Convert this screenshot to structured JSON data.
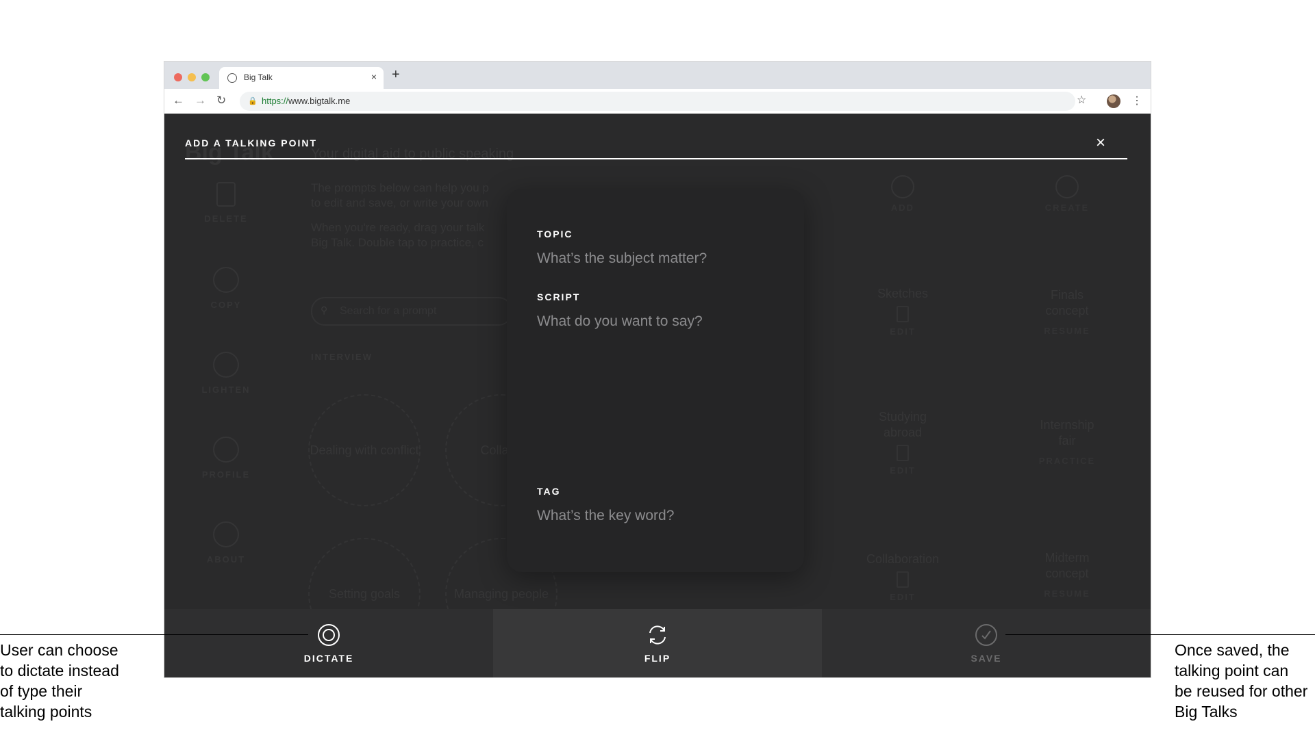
{
  "browser": {
    "tab_title": "Big Talk",
    "tab_close": "×",
    "new_tab": "+",
    "back": "←",
    "forward": "→",
    "reload": "↻",
    "lock": "🔒",
    "url_scheme": "https://",
    "url_host": "www.bigtalk.me",
    "bookmark_star": "☆",
    "menu": "⋮"
  },
  "background_app": {
    "app_title": "Big Talk",
    "tagline": "Your digital aid to public speaking",
    "intro_line1": "The prompts below can help you p",
    "intro_line1b": "to edit and save, or write your own",
    "intro_line2": "When you're ready, drag your talk",
    "intro_line2b": "Big Talk. Double tap to practice, c",
    "search_placeholder": "Search for a prompt",
    "category_tab": "INTERVIEW",
    "sidebar": [
      {
        "label": "DELETE"
      },
      {
        "label": "COPY"
      },
      {
        "label": "LIGHTEN"
      },
      {
        "label": "PROFILE"
      },
      {
        "label": "ABOUT"
      }
    ],
    "prompts": [
      "Dealing with conflict",
      "Collabo",
      "Setting goals",
      "Managing people"
    ],
    "top_actions": [
      "ADD",
      "CREATE"
    ],
    "saved_talks": [
      {
        "title": "Sketches",
        "action": "EDIT"
      },
      {
        "title": "Finals concept",
        "action": "RESUME"
      },
      {
        "title": "Studying abroad",
        "action": "EDIT"
      },
      {
        "title": "Internship fair",
        "action": "PRACTICE"
      },
      {
        "title": "Collaboration",
        "action": "EDIT"
      },
      {
        "title": "Midterm concept",
        "action": "RESUME"
      }
    ]
  },
  "modal": {
    "title": "ADD A TALKING POINT",
    "close": "×",
    "fields": {
      "topic_label": "TOPIC",
      "topic_placeholder": "What’s the subject matter?",
      "script_label": "SCRIPT",
      "script_placeholder": "What do you want to say?",
      "tag_label": "TAG",
      "tag_placeholder": "What’s the key word?"
    }
  },
  "actions": {
    "dictate": "DICTATE",
    "flip": "FLIP",
    "save": "SAVE"
  },
  "annotations": {
    "left": [
      "User can choose",
      "to dictate instead",
      "of type their",
      "talking points"
    ],
    "right": [
      "Once saved, the",
      "talking point can",
      "be reused for other",
      "Big Talks"
    ]
  }
}
